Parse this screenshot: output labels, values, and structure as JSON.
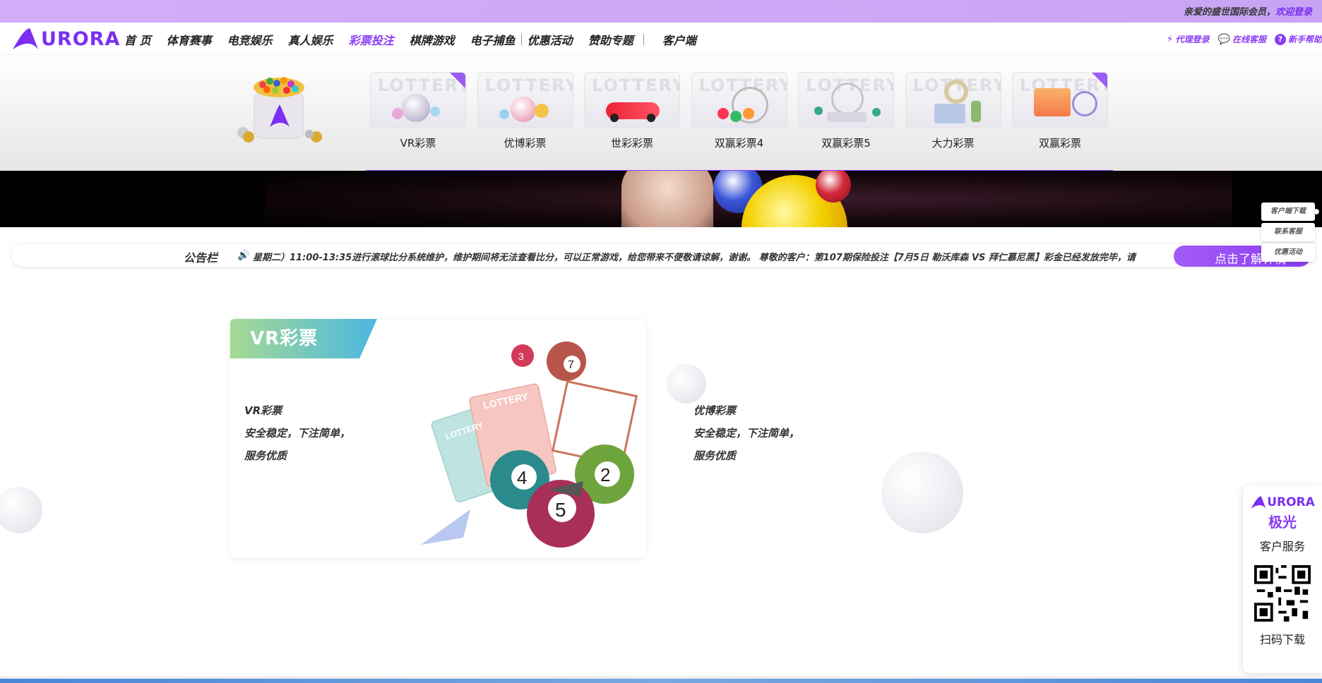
{
  "topbar": {
    "welcome": "亲爱的盛世国际会员，",
    "login_link": "欢迎登录"
  },
  "logo": {
    "text": "URORA"
  },
  "nav": {
    "items": [
      {
        "label": "首 页"
      },
      {
        "label": "体育赛事"
      },
      {
        "label": "电竞娱乐"
      },
      {
        "label": "真人娱乐"
      },
      {
        "label": "彩票投注",
        "active": true
      },
      {
        "label": "棋牌游戏"
      },
      {
        "label": "电子捕鱼"
      },
      {
        "label": "优惠活动"
      },
      {
        "label": "赞助专题"
      },
      {
        "label": "客户端"
      }
    ],
    "right": {
      "agent": "代理登录",
      "service": "在线客服",
      "help": "新手帮助"
    },
    "accent": "#8b3cf5"
  },
  "lottery_menu": {
    "cards": [
      {
        "label": "VR彩票"
      },
      {
        "label": "优博彩票"
      },
      {
        "label": "世彩彩票"
      },
      {
        "label": "双赢彩票4"
      },
      {
        "label": "双赢彩票5"
      },
      {
        "label": "大力彩票"
      },
      {
        "label": "双赢彩票"
      }
    ]
  },
  "notice": {
    "title": "公告栏",
    "message": "星期二）11:00-13:35进行滚球比分系统维护，维护期间将无法查看比分，可以正常游戏，给您带来不便敬请谅解，谢谢。  尊敬的客户：第107期保险投注【7月5日 勒沃库森 VS 拜仁慕尼黑】彩金已经发放完毕，请",
    "button": "点击了解详情"
  },
  "side_tabs": [
    "客户端下载",
    "联系客服",
    "优惠活动"
  ],
  "products": {
    "left": {
      "ribbon": "VR彩票",
      "name": "VR彩票",
      "line1": "安全稳定，下注简单，",
      "line2": "服务优质"
    },
    "right": {
      "name": "优博彩票",
      "line1": "安全稳定，下注简单，",
      "line2": "服务优质"
    }
  },
  "cs_panel": {
    "brand": "URORA",
    "cn": "极光",
    "title": "客户服务",
    "download": "扫码下载"
  }
}
